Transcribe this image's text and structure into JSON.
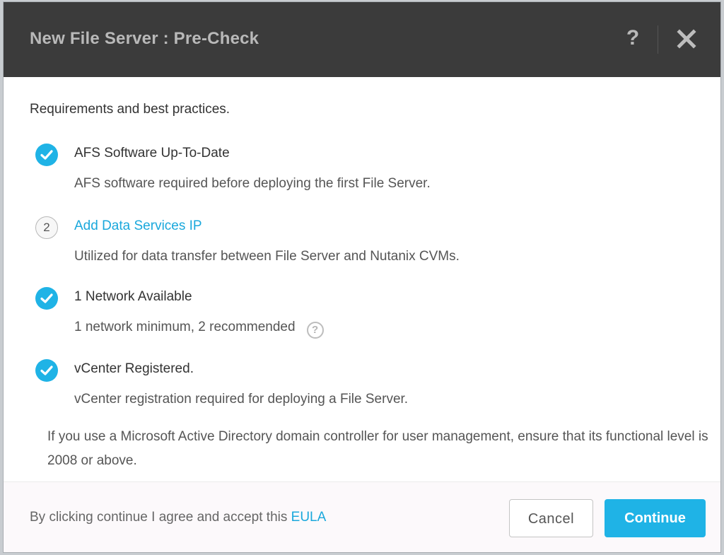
{
  "dialog": {
    "title": "New File Server : Pre-Check",
    "help_label": "?",
    "intro": "Requirements and best practices.",
    "items": [
      {
        "status": "complete",
        "icon": "check-circle-icon",
        "title": "AFS Software Up-To-Date",
        "description": "AFS software required before deploying the first File Server."
      },
      {
        "status": "pending",
        "step": "2",
        "title": "Add Data Services IP",
        "description": "Utilized for data transfer between File Server and Nutanix CVMs."
      },
      {
        "status": "complete",
        "icon": "check-circle-icon",
        "title": "1 Network Available",
        "description": "1 network minimum, 2 recommended",
        "info_icon": "?"
      },
      {
        "status": "complete",
        "icon": "check-circle-icon",
        "title": "vCenter Registered.",
        "description": "vCenter registration required for deploying a File Server."
      }
    ],
    "note": "If you use a Microsoft Active Directory domain controller for user management, ensure that its functional level is 2008 or above."
  },
  "footer": {
    "agreement_text": "By clicking continue I agree and accept this ",
    "eula_label": "EULA",
    "cancel_label": "Cancel",
    "continue_label": "Continue"
  },
  "colors": {
    "accent": "#1fb3e6",
    "link": "#1aa8dc",
    "header_bg": "#3b3b3b"
  }
}
